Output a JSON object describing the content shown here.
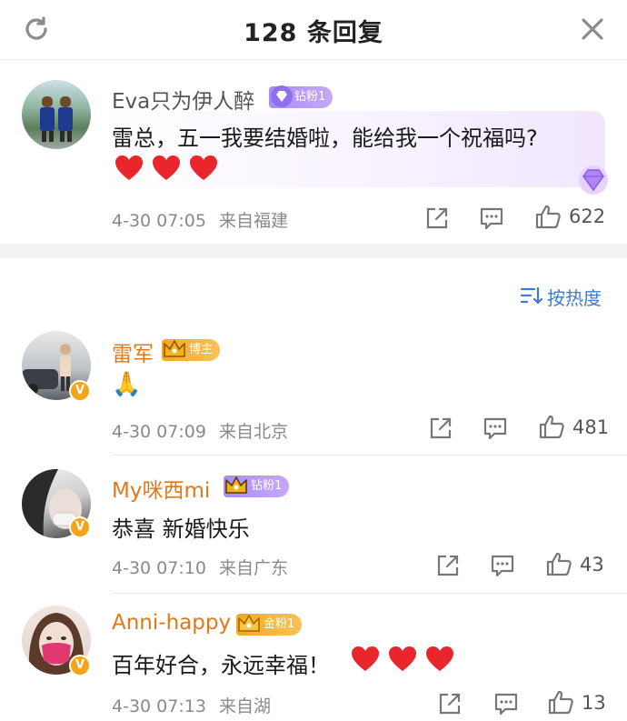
{
  "header": {
    "title": "128 条回复",
    "refresh_icon": "refresh-icon",
    "close_icon": "close-icon"
  },
  "root_comment": {
    "username": "Eva只为伊人醉",
    "badge": "钻粉1",
    "text": "雷总，五一我要结婚啦，能给我一个祝福吗?",
    "emoji": [
      "heart",
      "heart",
      "heart"
    ],
    "time": "4-30 07:05",
    "location": "来自福建",
    "likes": "622"
  },
  "sort": {
    "label": "按热度",
    "icon": "sort-icon"
  },
  "replies": [
    {
      "username": "雷军",
      "badge": "博主",
      "text": "🙏",
      "time": "4-30 07:09",
      "location": "来自北京",
      "likes": "481"
    },
    {
      "username": "My咪西mi",
      "badge": "钻粉1",
      "text": "恭喜 新婚快乐",
      "time": "4-30 07:10",
      "location": "来自广东",
      "likes": "43"
    },
    {
      "username": "Anni-happy",
      "badge": "金粉1",
      "text": "百年好合，永远幸福！",
      "emoji": [
        "heart",
        "heart",
        "heart"
      ],
      "time": "4-30 07:13",
      "location": "来自湖",
      "likes": "13"
    }
  ],
  "colors": {
    "accent_blue": "#3f7bd1",
    "username_orange": "#e0791b",
    "heart_red": "#e8262b",
    "badge_purple": "#a88cf5",
    "badge_gold": "#f6a623"
  }
}
